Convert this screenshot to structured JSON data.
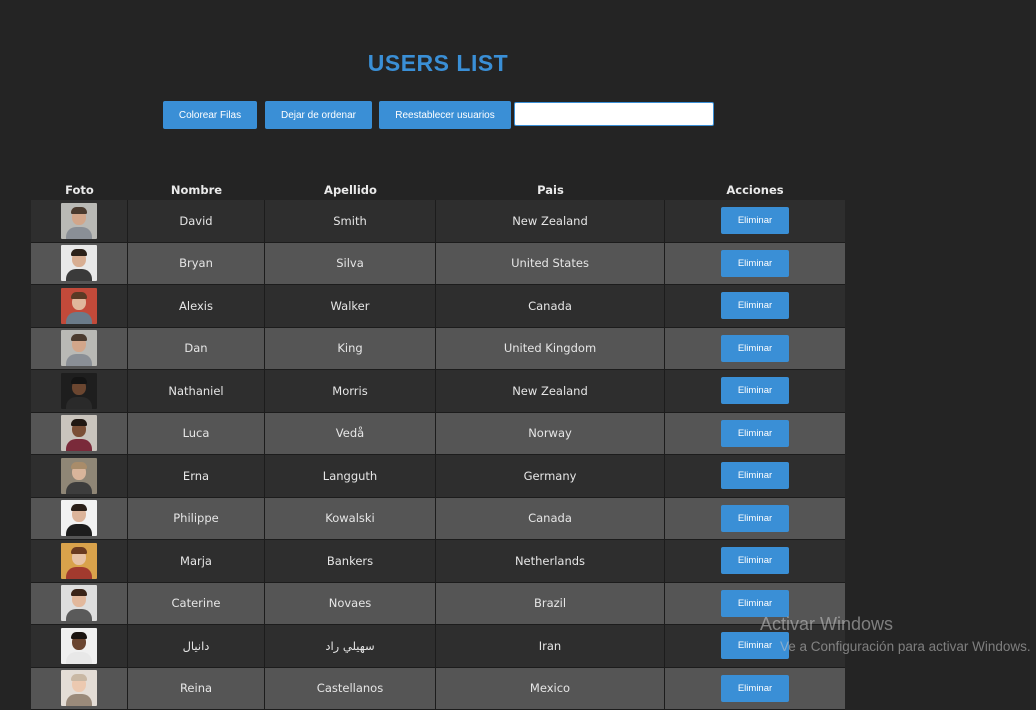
{
  "page": {
    "title": "USERS LIST"
  },
  "toolbar": {
    "buttons": [
      {
        "label": "Colorear Filas"
      },
      {
        "label": "Dejar de ordenar"
      },
      {
        "label": "Reestablecer usuarios"
      }
    ],
    "search": {
      "value": "",
      "placeholder": ""
    }
  },
  "table": {
    "headers": [
      "Foto",
      "Nombre",
      "Apellido",
      "Pais",
      "Acciones"
    ],
    "action_label": "Eliminar",
    "rows": [
      {
        "nombre": "David",
        "apellido": "Smith",
        "pais": "New Zealand",
        "photo": {
          "bg": "#b9b9b5",
          "skin": "#d2a68a",
          "hair": "#4a3a2e",
          "shirt": "#8a8f96"
        }
      },
      {
        "nombre": "Bryan",
        "apellido": "Silva",
        "pais": "United States",
        "photo": {
          "bg": "#e8e8e8",
          "skin": "#d8ae92",
          "hair": "#2b2119",
          "shirt": "#3a3a3a"
        }
      },
      {
        "nombre": "Alexis",
        "apellido": "Walker",
        "pais": "Canada",
        "photo": {
          "bg": "#c24a3a",
          "skin": "#e0b79c",
          "hair": "#5a3a25",
          "shirt": "#6b7b8a"
        }
      },
      {
        "nombre": "Dan",
        "apellido": "King",
        "pais": "United Kingdom",
        "photo": {
          "bg": "#b9b9b5",
          "skin": "#d2a68a",
          "hair": "#4a3a2e",
          "shirt": "#8a8f96"
        }
      },
      {
        "nombre": "Nathaniel",
        "apellido": "Morris",
        "pais": "New Zealand",
        "photo": {
          "bg": "#1e1e1e",
          "skin": "#6b4630",
          "hair": "#141414",
          "shirt": "#2a2a2a"
        }
      },
      {
        "nombre": "Luca",
        "apellido": "Vedå",
        "pais": "Norway",
        "photo": {
          "bg": "#c9c4bd",
          "skin": "#7a4f36",
          "hair": "#1f1712",
          "shirt": "#7a2a3a"
        }
      },
      {
        "nombre": "Erna",
        "apellido": "Langguth",
        "pais": "Germany",
        "photo": {
          "bg": "#8f8676",
          "skin": "#d9b59b",
          "hair": "#a98c6a",
          "shirt": "#3d3d3d"
        }
      },
      {
        "nombre": "Philippe",
        "apellido": "Kowalski",
        "pais": "Canada",
        "photo": {
          "bg": "#f2f2f2",
          "skin": "#dcb49a",
          "hair": "#2a1f18",
          "shirt": "#1d1d1d"
        }
      },
      {
        "nombre": "Marja",
        "apellido": "Bankers",
        "pais": "Netherlands",
        "photo": {
          "bg": "#d9a24b",
          "skin": "#e7c2a6",
          "hair": "#6a3a20",
          "shirt": "#a23a2e"
        }
      },
      {
        "nombre": "Caterine",
        "apellido": "Novaes",
        "pais": "Brazil",
        "photo": {
          "bg": "#dedede",
          "skin": "#e2b89c",
          "hair": "#3a2418",
          "shirt": "#5a5a5a"
        }
      },
      {
        "nombre": "دانيال",
        "apellido": "سهيلي راد",
        "pais": "Iran",
        "photo": {
          "bg": "#f0f0f0",
          "skin": "#6a4530",
          "hair": "#1a1410",
          "shirt": "#e8e8e8"
        }
      },
      {
        "nombre": "Reina",
        "apellido": "Castellanos",
        "pais": "Mexico",
        "photo": {
          "bg": "#e4ddd6",
          "skin": "#ecc9b0",
          "hair": "#c9b8a4",
          "shirt": "#9a8a7a"
        }
      }
    ]
  },
  "watermark": {
    "line1": "Activar Windows",
    "line2": "Ve a Configuración para activar Windows."
  },
  "colors": {
    "accent": "#3a8fd6",
    "background": "#242424",
    "row_dark": "#2e2e2e",
    "row_light": "#555555"
  }
}
